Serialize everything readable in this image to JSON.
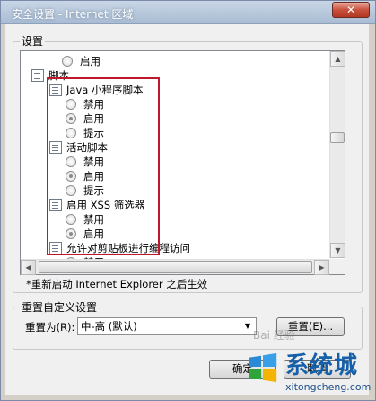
{
  "window": {
    "title": "安全设置 - Internet 区域",
    "close_label": "✕"
  },
  "settings_group": {
    "label": "设置"
  },
  "list": {
    "rows": [
      {
        "kind": "radio",
        "label": "启用",
        "selected": false
      },
      {
        "kind": "category",
        "label": "脚本",
        "icon": "script-settings-icon"
      },
      {
        "kind": "subcategory",
        "label": "Java 小程序脚本",
        "icon": "script-settings-icon"
      },
      {
        "kind": "radio",
        "label": "禁用",
        "selected": false
      },
      {
        "kind": "radio",
        "label": "启用",
        "selected": true
      },
      {
        "kind": "radio",
        "label": "提示",
        "selected": false
      },
      {
        "kind": "subcategory",
        "label": "活动脚本",
        "icon": "script-settings-icon"
      },
      {
        "kind": "radio",
        "label": "禁用",
        "selected": false
      },
      {
        "kind": "radio",
        "label": "启用",
        "selected": true
      },
      {
        "kind": "radio",
        "label": "提示",
        "selected": false
      },
      {
        "kind": "subcategory",
        "label": "启用 XSS 筛选器",
        "icon": "script-settings-icon"
      },
      {
        "kind": "radio",
        "label": "禁用",
        "selected": false
      },
      {
        "kind": "radio",
        "label": "启用",
        "selected": true
      },
      {
        "kind": "subcategory",
        "label": "允许对剪贴板进行编程访问",
        "icon": "script-settings-icon"
      },
      {
        "kind": "radio",
        "label": "禁用",
        "selected": false
      }
    ],
    "scroll_up": "▲",
    "scroll_down": "▼",
    "scroll_left": "◀",
    "scroll_right": "▶",
    "highlight_color": "#c0182a"
  },
  "restart_note": "*重新启动 Internet Explorer 之后生效",
  "reset_group": {
    "label": "重置自定义设置",
    "reset_to_label": "重置为(R):",
    "reset_level": "中-高 (默认)",
    "dropdown_arrow": "▼",
    "reset_button": "重置(E)..."
  },
  "footer": {
    "ok_label": "确定",
    "cancel_label": "取消"
  },
  "watermark": {
    "site_name": "系统城",
    "site_url": "xitongcheng.com",
    "baidu_text": "Bai 经验"
  }
}
